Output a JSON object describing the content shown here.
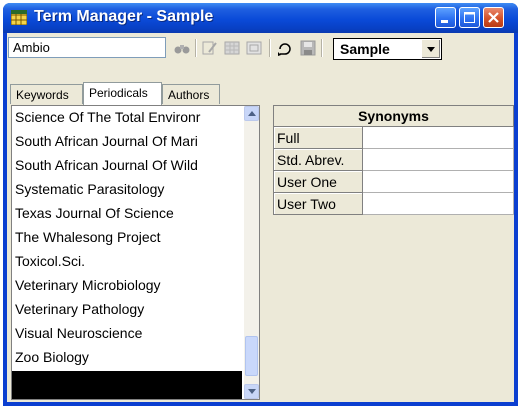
{
  "window": {
    "title": "Term Manager - Sample"
  },
  "toolbar": {
    "search_value": "Ambio",
    "icons": [
      "binoculars-icon",
      "edit-icon",
      "grid-icon",
      "replace-icon",
      "undo-icon",
      "save-icon"
    ],
    "database_select": "Sample"
  },
  "tabs": [
    {
      "label": "Keywords",
      "active": false
    },
    {
      "label": "Periodicals",
      "active": true
    },
    {
      "label": "Authors",
      "active": false
    }
  ],
  "list": {
    "items": [
      "Science Of The Total Environr",
      "South African Journal Of Mari",
      "South African Journal Of Wild",
      "Systematic Parasitology",
      "Texas Journal Of Science",
      "The Whalesong Project",
      "Toxicol.Sci.",
      "Veterinary Microbiology",
      "Veterinary Pathology",
      "Visual Neuroscience",
      "Zoo Biology"
    ]
  },
  "synonyms": {
    "header": "Synonyms",
    "rows": [
      {
        "label": "Full",
        "value": ""
      },
      {
        "label": "Std. Abrev.",
        "value": ""
      },
      {
        "label": "User One",
        "value": ""
      },
      {
        "label": "User Two",
        "value": ""
      }
    ]
  },
  "colors": {
    "titlebar": "#0a4ad8",
    "face": "#ece9d8",
    "close": "#d4522a"
  }
}
